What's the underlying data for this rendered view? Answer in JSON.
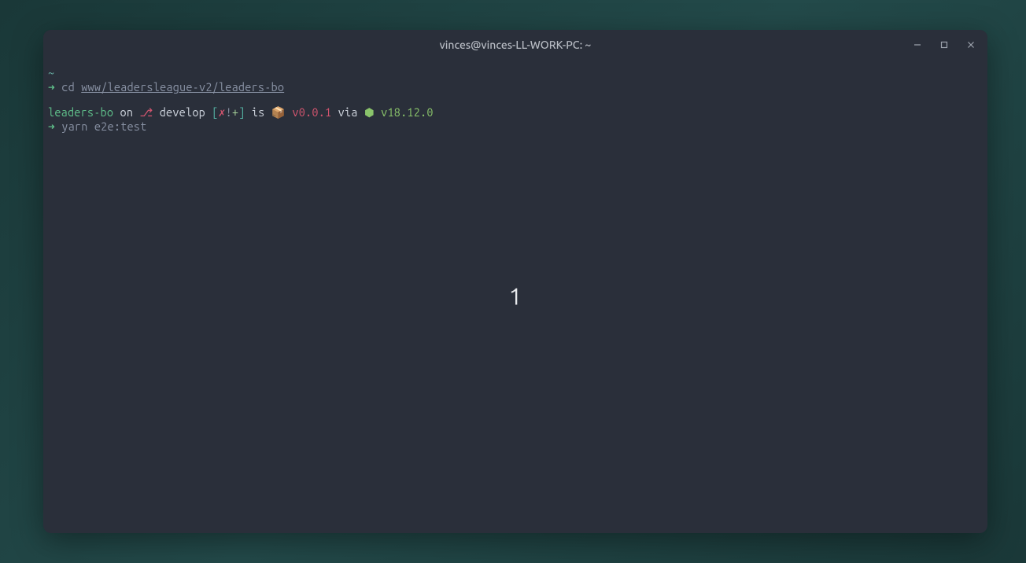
{
  "titlebar": {
    "title": "vinces@vinces-LL-WORK-PC: ~"
  },
  "terminal": {
    "line1": {
      "tilde": "~"
    },
    "line2": {
      "arrow": "➜",
      "cmd": "cd ",
      "path": "www/leadersleague-v2/leaders-bo"
    },
    "prompt": {
      "repo": "leaders-bo",
      "on": " on ",
      "branch_icon": "⎇",
      "branch": " develop ",
      "bracket_open": "[",
      "red_x": "✗",
      "excl": "!",
      "plus": "+",
      "bracket_close": "]",
      "is": " is ",
      "pkg_icon": "📦",
      "version": " v0.0.1",
      "via": " via ",
      "node_icon": "⬢ ",
      "node_ver": "v18.12.0"
    },
    "line4": {
      "arrow": "➜",
      "cmd": "yarn e2e:test"
    },
    "center": "1"
  }
}
